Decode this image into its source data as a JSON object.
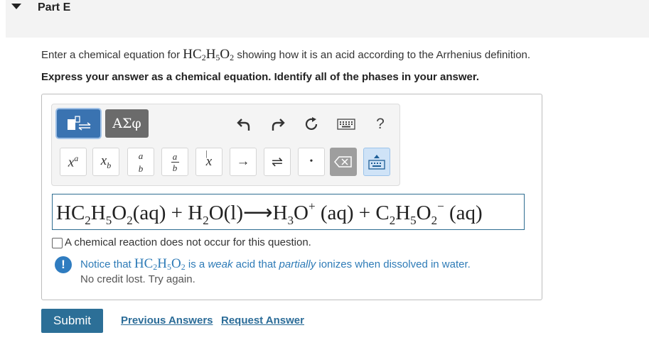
{
  "part": {
    "title": "Part E"
  },
  "question": {
    "prompt_before": "Enter a chemical equation for ",
    "formula": [
      "HC",
      "2",
      "H",
      "5",
      "O",
      "2"
    ],
    "prompt_after": " showing how it is an acid according to the Arrhenius definition.",
    "instruction": "Express your answer as a chemical equation. Identify all of the phases in your answer."
  },
  "toolbar": {
    "mode_templates_icon": "template-arrows-icon",
    "mode_symbols_label": "ΑΣφ",
    "undo_icon": "undo-icon",
    "redo_icon": "redo-icon",
    "reset_icon": "reset-icon",
    "keyboard_icon": "keyboard-icon",
    "help_label": "?",
    "buttons": {
      "superscript_base": "x",
      "superscript_exp": "a",
      "subscript_base": "x",
      "subscript_index": "b",
      "frac_num": "a",
      "frac_den": "b",
      "frac_bar_num": "a",
      "frac_bar_den": "b",
      "vector": "x",
      "mean": "x",
      "arrow": "→",
      "equilibrium": "⇌",
      "dot": "•"
    }
  },
  "answer": {
    "equation": {
      "p1": "HC",
      "s1": "2",
      "p2": "H",
      "s2": "5",
      "p3": "O",
      "s3": "2",
      "p4": "(aq) + H",
      "s4": "2",
      "p5": "O(l)⟶H",
      "s5": "3",
      "p6": "O",
      "sup1": "+",
      "p7": " (aq) + C",
      "s6": "2",
      "p8": "H",
      "s7": "5",
      "p9": "O",
      "s8": "2",
      "sup2": "−",
      "p10": " (aq)"
    }
  },
  "no_reaction": {
    "label": "A chemical reaction does not occur for this question."
  },
  "feedback": {
    "before": "Notice that ",
    "mid": " is a ",
    "weak": "weak",
    "mid2": " acid that ",
    "partially": "partially",
    "after": " ionizes when dissolved in water.",
    "credit": "No credit lost. Try again.",
    "icon": "info-exclamation-icon"
  },
  "actions": {
    "submit": "Submit",
    "previous_answers": "Previous Answers",
    "request_answer": "Request Answer"
  },
  "colors": {
    "accent_blue": "#2c6f97",
    "templates_button": "#3a73b1",
    "symbols_button": "#6b6b6b",
    "feedback_text": "#2e7bb7"
  }
}
